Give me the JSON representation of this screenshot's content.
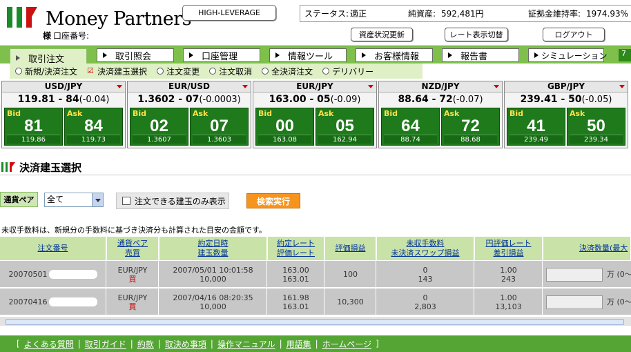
{
  "brand": {
    "name": "Money Partners",
    "sama": "様",
    "account_label": "口座番号:",
    "colors": {
      "green": "#7fc04d",
      "dark_green": "#1f7a1c",
      "accent": "#c00000",
      "orange": "#f7941e"
    }
  },
  "header": {
    "leverage_button": "HIGH-LEVERAGE",
    "status_label": "ステータス:",
    "status_value": "適正",
    "net_assets_label": "純資産:",
    "net_assets_value": "592,481円",
    "margin_rate_label": "証拠金維持率:",
    "margin_rate_value": "1974.93%",
    "refresh_button": "資産状況更新",
    "rate_toggle_button": "レート表示切替",
    "logout_button": "ログアウト"
  },
  "nav": {
    "tabs": [
      "取引注文",
      "取引照会",
      "口座管理",
      "情報ツール",
      "お客様情報",
      "報告書",
      "シミュレーション"
    ],
    "end_label": "7"
  },
  "subnav": {
    "items": [
      "新規/決済注文",
      "決済建玉選択",
      "注文変更",
      "注文取消",
      "全決済注文",
      "デリバリー"
    ]
  },
  "rates": [
    {
      "pair": "USD/JPY",
      "quote": "119.81 - 84",
      "change": "(-0.04)",
      "bid_label": "Bid",
      "bid_big": "81",
      "bid_small": "119.86",
      "ask_label": "Ask",
      "ask_big": "84",
      "ask_small": "119.73"
    },
    {
      "pair": "EUR/USD",
      "quote": "1.3602 - 07",
      "change": "(-0.0003)",
      "bid_label": "Bid",
      "bid_big": "02",
      "bid_small": "1.3607",
      "ask_label": "Ask",
      "ask_big": "07",
      "ask_small": "1.3603"
    },
    {
      "pair": "EUR/JPY",
      "quote": "163.00 - 05",
      "change": "(-0.09)",
      "bid_label": "Bid",
      "bid_big": "00",
      "bid_small": "163.08",
      "ask_label": "Ask",
      "ask_big": "05",
      "ask_small": "162.94"
    },
    {
      "pair": "NZD/JPY",
      "quote": "88.64 - 72",
      "change": "(-0.07)",
      "bid_label": "Bid",
      "bid_big": "64",
      "bid_small": "88.74",
      "ask_label": "Ask",
      "ask_big": "72",
      "ask_small": "88.68"
    },
    {
      "pair": "GBP/JPY",
      "quote": "239.41 - 50",
      "change": "(-0.05)",
      "bid_label": "Bid",
      "bid_big": "41",
      "bid_small": "239.49",
      "ask_label": "Ask",
      "ask_big": "50",
      "ask_small": "239.34"
    }
  ],
  "section": {
    "title": "決済建玉選択"
  },
  "filter": {
    "pair_label": "通貨ペア",
    "pair_value": "全て",
    "only_orderable_label": "注文できる建玉のみ表示",
    "search_button": "検索実行"
  },
  "note": "未収手数料は、新規分の手数料に基づき決済分も計算された目安の金額です。",
  "table": {
    "headers": [
      [
        "注文番号"
      ],
      [
        "通貨ペア",
        "売買"
      ],
      [
        "約定日時",
        "建玉数量"
      ],
      [
        "約定レート",
        "評価レート"
      ],
      [
        "評価損益"
      ],
      [
        "未収手数料",
        "未決済スワップ損益"
      ],
      [
        "円評価レート",
        "差引損益"
      ],
      [
        "決済数量(最大"
      ]
    ],
    "rows": [
      {
        "order_no": "20070501",
        "pair": "EUR/JPY",
        "side": "買",
        "datetime": "2007/05/01 10:01:58",
        "qty": "10,000",
        "rate": "163.00",
        "eval_rate": "163.01",
        "pl": "100",
        "fee": "0",
        "swap": "143",
        "yen_rate": "1.00",
        "net_pl": "243",
        "unit": "万",
        "range": "(0～"
      },
      {
        "order_no": "20070416",
        "pair": "EUR/JPY",
        "side": "買",
        "datetime": "2007/04/16 08:20:35",
        "qty": "10,000",
        "rate": "161.98",
        "eval_rate": "163.01",
        "pl": "10,300",
        "fee": "0",
        "swap": "2,803",
        "yen_rate": "1.00",
        "net_pl": "13,103",
        "unit": "万",
        "range": "(0～"
      }
    ]
  },
  "footer": {
    "links": [
      "よくある質問",
      "取引ガイド",
      "約款",
      "取決め事項",
      "操作マニュアル",
      "用語集",
      "ホームページ"
    ]
  }
}
